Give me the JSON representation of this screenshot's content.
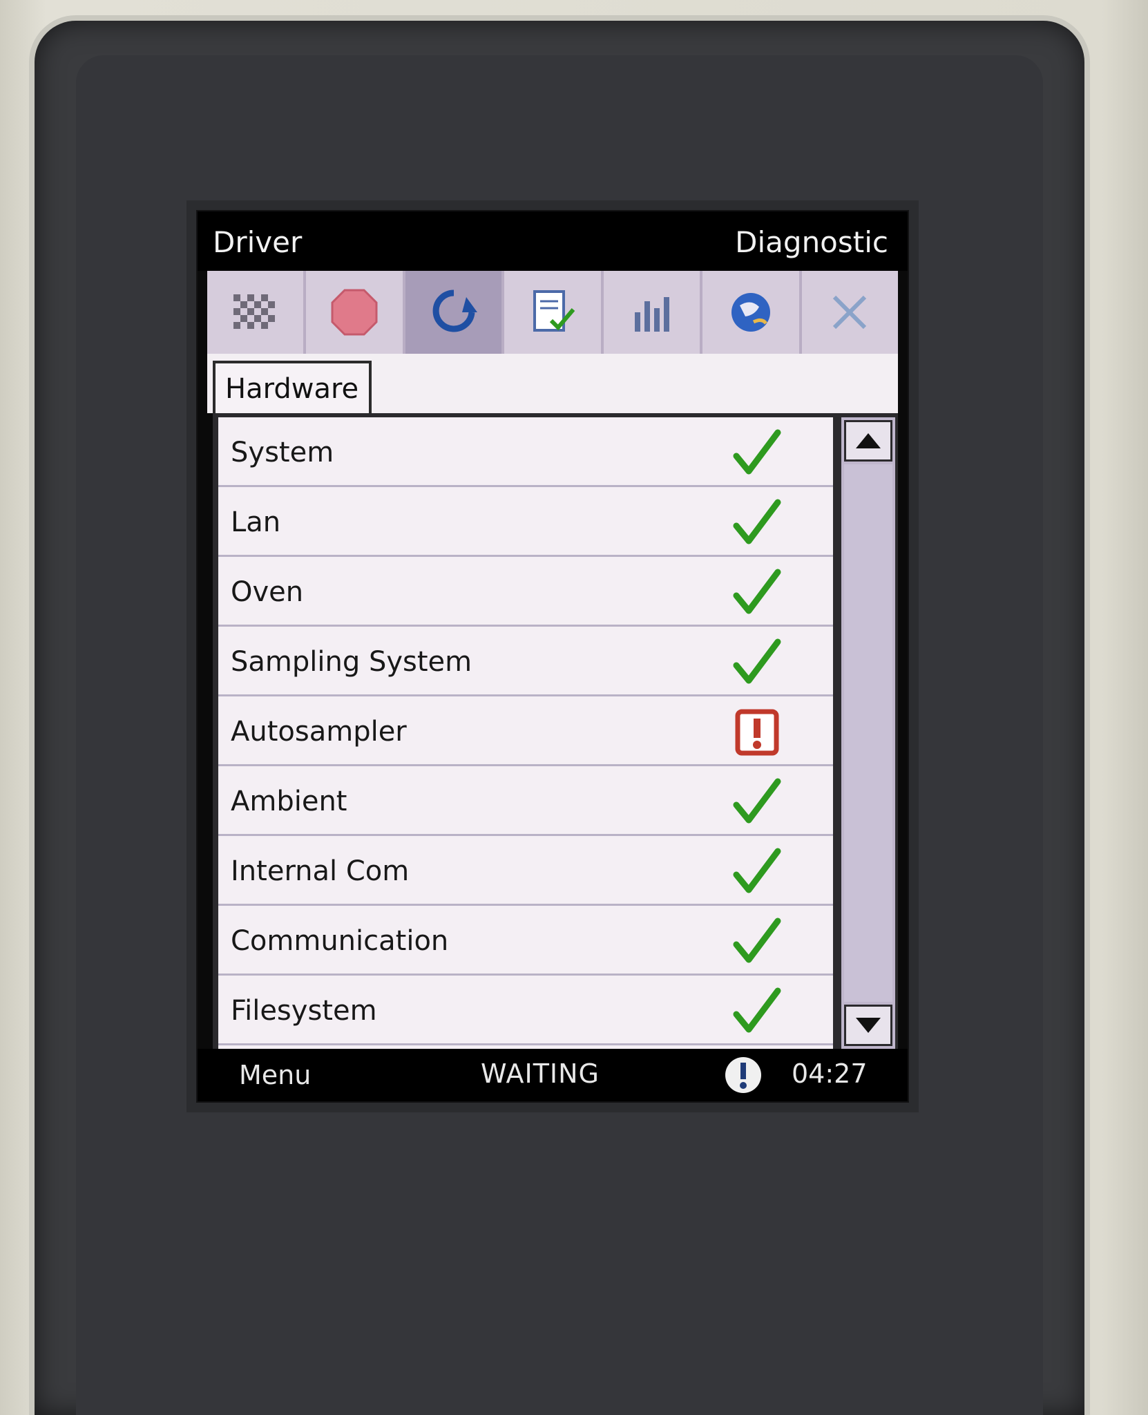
{
  "header": {
    "left_title": "Driver",
    "right_title": "Diagnostic"
  },
  "toolbar": {
    "buttons": [
      {
        "icon": "checker-grid-icon"
      },
      {
        "icon": "stop-sign-icon"
      },
      {
        "icon": "refresh-icon",
        "active": true
      },
      {
        "icon": "document-check-icon"
      },
      {
        "icon": "bar-chart-icon"
      },
      {
        "icon": "globe-icon"
      },
      {
        "icon": "close-icon"
      }
    ]
  },
  "tabs": [
    {
      "label": "Hardware",
      "selected": true
    }
  ],
  "diagnostics": {
    "items": [
      {
        "label": "System",
        "status": "ok"
      },
      {
        "label": "Lan",
        "status": "ok"
      },
      {
        "label": "Oven",
        "status": "ok"
      },
      {
        "label": "Sampling System",
        "status": "ok"
      },
      {
        "label": "Autosampler",
        "status": "error"
      },
      {
        "label": "Ambient",
        "status": "ok"
      },
      {
        "label": "Internal Com",
        "status": "ok"
      },
      {
        "label": "Communication",
        "status": "ok"
      },
      {
        "label": "Filesystem",
        "status": "ok"
      }
    ]
  },
  "statusbar": {
    "menu_label": "Menu",
    "state": "WAITING",
    "alert_icon": "warning-icon",
    "time": "04:27"
  },
  "colors": {
    "ok": "#2e9a1f",
    "error": "#c0392b",
    "toolbar_bg": "#d6ccdc",
    "list_bg": "#f4eff4"
  }
}
